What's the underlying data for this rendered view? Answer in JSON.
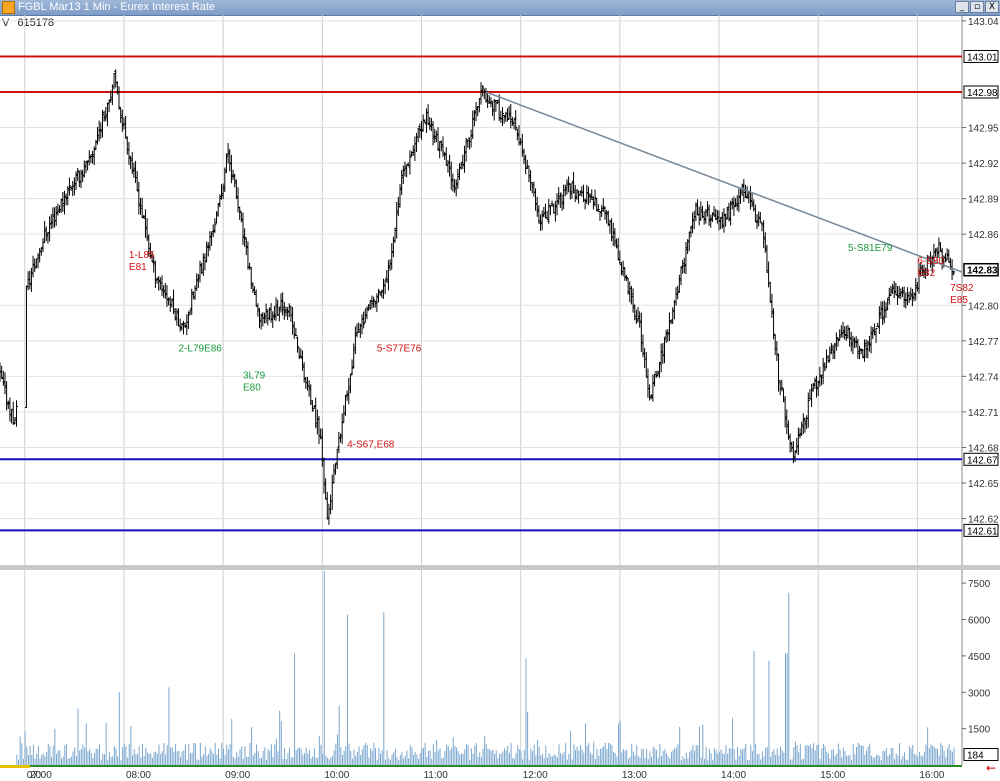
{
  "window": {
    "title": "FGBL Mar13 1 Min - Eurex Interest Rate",
    "buttons": [
      "_",
      "▫",
      "X"
    ]
  },
  "info": {
    "v_label": "V",
    "v_value": "615178"
  },
  "colors": {
    "resistance": "#d01010",
    "support": "#1010c0",
    "trendline": "#778899",
    "bars": "#000000",
    "volume": "#7aa7cf",
    "annotation_red": "#d01010",
    "annotation_green": "#1a9a3a"
  },
  "chart_data": [
    {
      "type": "ohlc",
      "title": "FGBL Mar13 1 Min - Eurex Interest Rate",
      "ylim": [
        142.585,
        143.045
      ],
      "yticks": [
        "143.04",
        "142.95",
        "142.92",
        "142.89",
        "142.86",
        "142.80",
        "142.77",
        "142.74",
        "142.71",
        "142.68",
        "142.65",
        "142.62"
      ],
      "x_labels": [
        "07:00",
        "08:00",
        "09:00",
        "10:00",
        "11:00",
        "12:00",
        "13:00",
        "14:00",
        "15:00",
        "16:00"
      ],
      "x_partial_label": "20",
      "xlim_hours": [
        6.75,
        16.45
      ],
      "horizontal_lines": [
        {
          "price": 143.01,
          "label": "143.01",
          "role": "resistance"
        },
        {
          "price": 142.98,
          "label": "142.98",
          "role": "resistance"
        },
        {
          "price": 142.67,
          "label": "142.67",
          "role": "support"
        },
        {
          "price": 142.61,
          "label": "142.61",
          "role": "support"
        }
      ],
      "last_price": {
        "price": 142.83,
        "label": "142.83"
      },
      "trendline": [
        {
          "time": 11.65,
          "price": 142.98
        },
        {
          "time": 16.45,
          "price": 142.828
        }
      ],
      "price_path": [
        [
          6.75,
          142.74
        ],
        [
          6.9,
          142.7
        ],
        [
          7.0,
          142.81
        ],
        [
          7.2,
          142.86
        ],
        [
          7.45,
          142.9
        ],
        [
          7.65,
          142.92
        ],
        [
          7.9,
          142.99
        ],
        [
          8.3,
          142.83
        ],
        [
          8.6,
          142.78
        ],
        [
          8.95,
          142.88
        ],
        [
          9.05,
          142.93
        ],
        [
          9.35,
          142.79
        ],
        [
          9.65,
          142.8
        ],
        [
          9.85,
          142.73
        ],
        [
          9.98,
          142.69
        ],
        [
          10.05,
          142.62
        ],
        [
          10.35,
          142.78
        ],
        [
          10.65,
          142.82
        ],
        [
          10.8,
          142.91
        ],
        [
          11.05,
          142.96
        ],
        [
          11.35,
          142.9
        ],
        [
          11.6,
          142.98
        ],
        [
          11.95,
          142.95
        ],
        [
          12.2,
          142.87
        ],
        [
          12.5,
          142.9
        ],
        [
          12.85,
          142.88
        ],
        [
          13.2,
          142.78
        ],
        [
          13.3,
          142.72
        ],
        [
          13.55,
          142.8
        ],
        [
          13.75,
          142.88
        ],
        [
          14.05,
          142.87
        ],
        [
          14.25,
          142.9
        ],
        [
          14.45,
          142.86
        ],
        [
          14.6,
          142.74
        ],
        [
          14.75,
          142.67
        ],
        [
          14.95,
          142.73
        ],
        [
          15.25,
          142.78
        ],
        [
          15.45,
          142.76
        ],
        [
          15.75,
          142.81
        ],
        [
          15.95,
          142.81
        ],
        [
          16.05,
          142.83
        ],
        [
          16.2,
          142.85
        ],
        [
          16.35,
          142.83
        ]
      ],
      "annotations": [
        {
          "time": 8.05,
          "price": 142.84,
          "lines": [
            "1-L85",
            "E81"
          ],
          "color": "red"
        },
        {
          "time": 8.55,
          "price": 142.761,
          "lines": [
            "2-L79E86"
          ],
          "color": "green"
        },
        {
          "time": 9.2,
          "price": 142.738,
          "lines": [
            "3L79",
            "E80"
          ],
          "color": "green"
        },
        {
          "time": 10.25,
          "price": 142.68,
          "lines": [
            "4-S67,E68"
          ],
          "color": "red"
        },
        {
          "time": 10.55,
          "price": 142.761,
          "lines": [
            "5-S77E76"
          ],
          "color": "red"
        },
        {
          "time": 15.3,
          "price": 142.846,
          "lines": [
            "5-S81E79"
          ],
          "color": "green"
        },
        {
          "time": 16.0,
          "price": 142.835,
          "lines": [
            "6-S80",
            "E82"
          ],
          "color": "red"
        },
        {
          "time": 16.33,
          "price": 142.812,
          "lines": [
            "7S82",
            "E85"
          ],
          "color": "red"
        }
      ]
    },
    {
      "type": "bar",
      "title": "Volume",
      "ylim": [
        0,
        8000
      ],
      "yticks": [
        "7500",
        "6000",
        "4500",
        "3000",
        "1500"
      ],
      "last_value": {
        "value": 184,
        "label": "184"
      },
      "spikes": [
        {
          "time": 10.02,
          "value": 8000
        },
        {
          "time": 10.25,
          "value": 6200
        },
        {
          "time": 10.62,
          "value": 6300
        },
        {
          "time": 14.7,
          "value": 7100
        },
        {
          "time": 9.72,
          "value": 4600
        },
        {
          "time": 12.05,
          "value": 4400
        },
        {
          "time": 14.35,
          "value": 4700
        },
        {
          "time": 14.68,
          "value": 4600
        },
        {
          "time": 7.95,
          "value": 3000
        },
        {
          "time": 8.45,
          "value": 3200
        },
        {
          "time": 14.5,
          "value": 4300
        }
      ],
      "baseline_volume": 800
    }
  ]
}
